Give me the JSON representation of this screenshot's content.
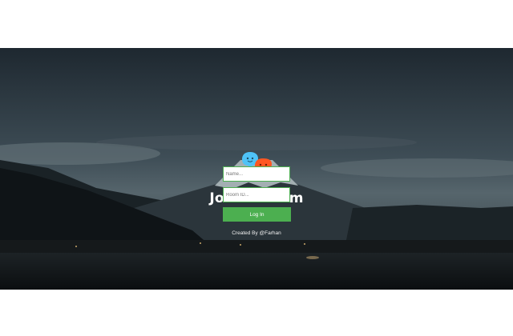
{
  "form": {
    "title": "Join A Room",
    "name_placeholder": "Name...",
    "room_placeholder": "Room ID...",
    "submit_label": "Log In",
    "credit": "Created By @Farhan"
  },
  "logo": {
    "icon": "chat-bubbles-icon",
    "colors": [
      "#4fc3f7",
      "#ff5722"
    ]
  },
  "colors": {
    "accent": "#4caf50"
  }
}
